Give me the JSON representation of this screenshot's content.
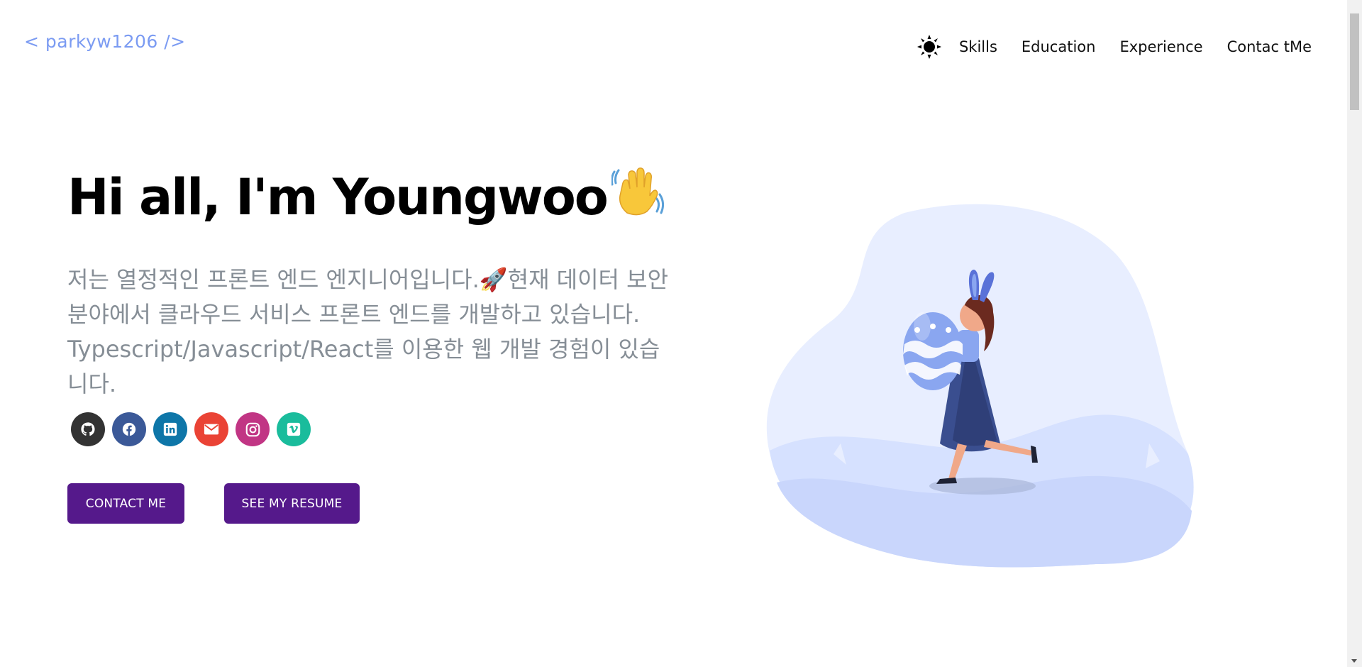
{
  "header": {
    "logo": "< parkyw1206 />",
    "theme_toggle_icon": "sun-icon",
    "nav": [
      {
        "label": "Skills"
      },
      {
        "label": "Education"
      },
      {
        "label": "Experience"
      },
      {
        "label": "Contac tMe"
      }
    ]
  },
  "hero": {
    "greeting": "Hi all, I'm Youngwoo",
    "greeting_emoji": "waving-hand-icon",
    "intro": "저는 열정적인 프론트 엔드 엔지니어입니다.🚀현재 데이터 보안 분야에서 클라우드 서비스 프론트 엔드를 개발하고 있습니다. Typescript/Javascript/React를 이용한 웹 개발 경험이 있습니다.",
    "socials": [
      {
        "icon": "github-icon",
        "color": "#333333"
      },
      {
        "icon": "facebook-icon",
        "color": "#3b5998"
      },
      {
        "icon": "linkedin-icon",
        "color": "#0e76a8"
      },
      {
        "icon": "email-icon",
        "color": "#ea4335"
      },
      {
        "icon": "instagram-icon",
        "color": "#c13584"
      },
      {
        "icon": "vimeo-icon",
        "color": "#1ab7ea"
      }
    ],
    "buttons": {
      "contact": "CONTACT ME",
      "resume": "SEE MY RESUME"
    },
    "button_color": "#55198b",
    "illustration": "girl-carrying-easter-egg-illustration"
  },
  "colors": {
    "accent": "#55198b",
    "logo": "#7b9bf2",
    "subtitle": "#868e96"
  }
}
